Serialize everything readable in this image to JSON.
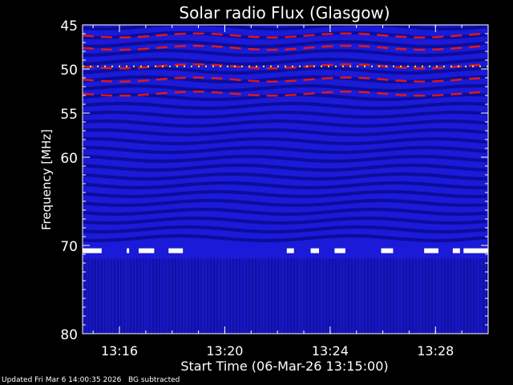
{
  "chart_data": {
    "type": "heatmap",
    "title": "Solar radio Flux (Glasgow)",
    "xlabel": "Start Time (06-Mar-26 13:15:00)",
    "ylabel": "Frequency [MHz]",
    "x_ticks": [
      "13:16",
      "13:20",
      "13:24",
      "13:28"
    ],
    "x_tick_minutes": [
      1,
      5,
      9,
      13
    ],
    "xlim_minutes": [
      -0.4,
      15.0
    ],
    "y_ticks": [
      45,
      50,
      55,
      60,
      70,
      80
    ],
    "ylim": [
      45,
      80
    ],
    "y_reversed": true,
    "background_subtracted": true,
    "colors": {
      "background": "#1a1ad8",
      "dark_band": "#0a0a90",
      "bright_band": "#ff1a00",
      "peak": "#ffee00",
      "blank": "#ffffff"
    },
    "bright_bands_mhz": [
      46.2,
      47.6,
      49.7,
      51.2,
      52.8
    ],
    "interference_line_mhz": 49.7,
    "blank_segments": {
      "frequency_mhz": 70.6,
      "minutes": [
        [
          0.0,
          0.8
        ],
        [
          1.85,
          1.95
        ],
        [
          2.35,
          3.0
        ],
        [
          3.6,
          4.2
        ],
        [
          8.55,
          8.85
        ],
        [
          9.55,
          9.9
        ],
        [
          10.55,
          11.0
        ],
        [
          12.5,
          13.0
        ],
        [
          14.3,
          14.9
        ],
        [
          15.5,
          15.8
        ],
        [
          15.95,
          17.8
        ]
      ]
    },
    "grid": false
  },
  "footer": {
    "updated": "Updated Fri Mar 6 14:00:35 2026",
    "note": "BG subtracted"
  }
}
